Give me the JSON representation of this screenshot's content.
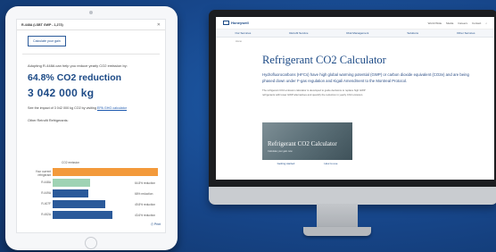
{
  "tablet": {
    "header_title": "R-448A (LSBT GWP - 1,273)",
    "close_icon": "close-icon",
    "calculate_button": "Calculate your gain",
    "intro_text": "Adopting R-448A can help you reduce yearly CO2 emission by:",
    "reduction_percent": "64.8% CO2 reduction",
    "reduction_amount": "3 042 000 kg",
    "see_prefix": "See the impact of 3 042 000 kg CO2 by visiting",
    "see_link": "EPA GHG calculator",
    "other_title": "Other Retrofit Refrigerants:",
    "print_label": "Print",
    "print_icon": "print-icon"
  },
  "chart_data": {
    "type": "bar",
    "orientation": "horizontal",
    "title": "",
    "xlabel": "CO2 emission",
    "ylabel": "",
    "categories": [
      "Your current refrigerant",
      "R-448A",
      "R-449A",
      "R-407F",
      "R-452A"
    ],
    "values": [
      100,
      35.2,
      34.0,
      50.2,
      56.4
    ],
    "value_labels": [
      "",
      "64.8% reduction",
      "66% reduction",
      "49.8% reduction",
      "43.6% reduction"
    ],
    "colors": [
      "#f39a3b",
      "#9fd3b4",
      "#2b5a9a",
      "#2b5a9a",
      "#2b5a9a"
    ],
    "xlim": [
      0,
      100
    ]
  },
  "monitor": {
    "logo_text": "Honeywell",
    "logo_icon": "brand-logo-icon",
    "util_links": [
      "World Wide",
      "Media",
      "Careers",
      "Contact",
      "Search"
    ],
    "nav": [
      "Our Services",
      "Retrofit Service",
      "Risk Management",
      "Solutions",
      "Other Services"
    ],
    "breadcrumb": "Home",
    "page_title": "Refrigerant CO2 Calculator",
    "description": "Hydrofluorocarbons (HFCs) have high global warming potential (GWP) or carbon dioxide equivalent (CO2e) and are being phased down under F-gas regulation and Kigali Amendment to the Montreal Protocol.",
    "body_text": "The refrigerant CO2 emission calculator is developed to guide decisions to replace high GWP refrigerants with lower GWP alternatives and quantify the reduction in yearly CO2 emission.",
    "hero_title": "Refrigerant CO2 Calculator",
    "hero_subtitle": "Calculate your gain now",
    "links": [
      "Getting started",
      "How to use"
    ]
  },
  "colors": {
    "background": "#17468a",
    "brand": "#1c4a86",
    "current_refrigerant": "#f39a3b",
    "r448a": "#9fd3b4",
    "alternatives": "#2b5a9a"
  }
}
